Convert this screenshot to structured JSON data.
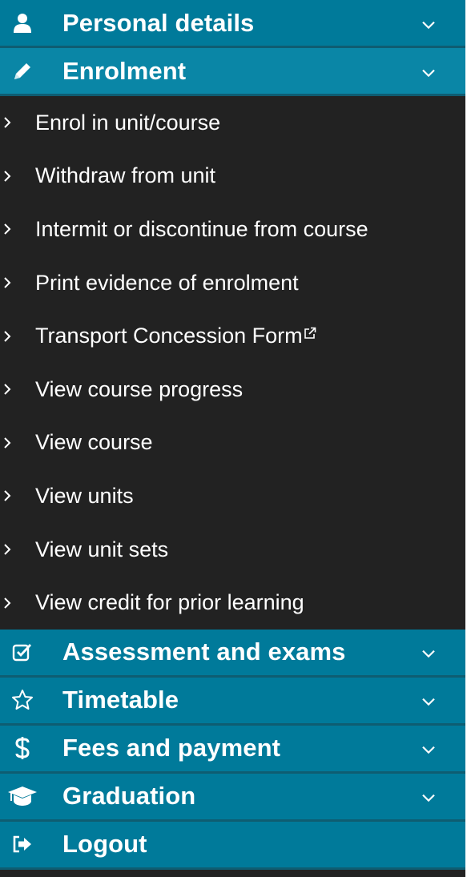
{
  "colors": {
    "header_bg": "#007a9a",
    "header_border": "#0e5d72",
    "submenu_bg": "#222222",
    "text": "#ffffff"
  },
  "sections": [
    {
      "label": "Personal details",
      "icon": "user-icon",
      "expanded": false
    },
    {
      "label": "Enrolment",
      "icon": "pencil-icon",
      "expanded": true
    },
    {
      "label": "Assessment and exams",
      "icon": "checkbox-icon",
      "expanded": false
    },
    {
      "label": "Timetable",
      "icon": "star-icon",
      "expanded": false
    },
    {
      "label": "Fees and payment",
      "icon": "dollar-icon",
      "expanded": false
    },
    {
      "label": "Graduation",
      "icon": "graduation-cap-icon",
      "expanded": false
    },
    {
      "label": "Logout",
      "icon": "logout-icon",
      "expanded": false
    }
  ],
  "enrolment_items": [
    {
      "label": "Enrol in unit/course"
    },
    {
      "label": "Withdraw from unit"
    },
    {
      "label": "Intermit or discontinue from course"
    },
    {
      "label": "Print evidence of enrolment"
    },
    {
      "label": "Transport Concession Form",
      "external": true
    },
    {
      "label": "View course progress"
    },
    {
      "label": "View course"
    },
    {
      "label": "View units"
    },
    {
      "label": "View unit sets"
    },
    {
      "label": "View credit for prior learning"
    }
  ]
}
